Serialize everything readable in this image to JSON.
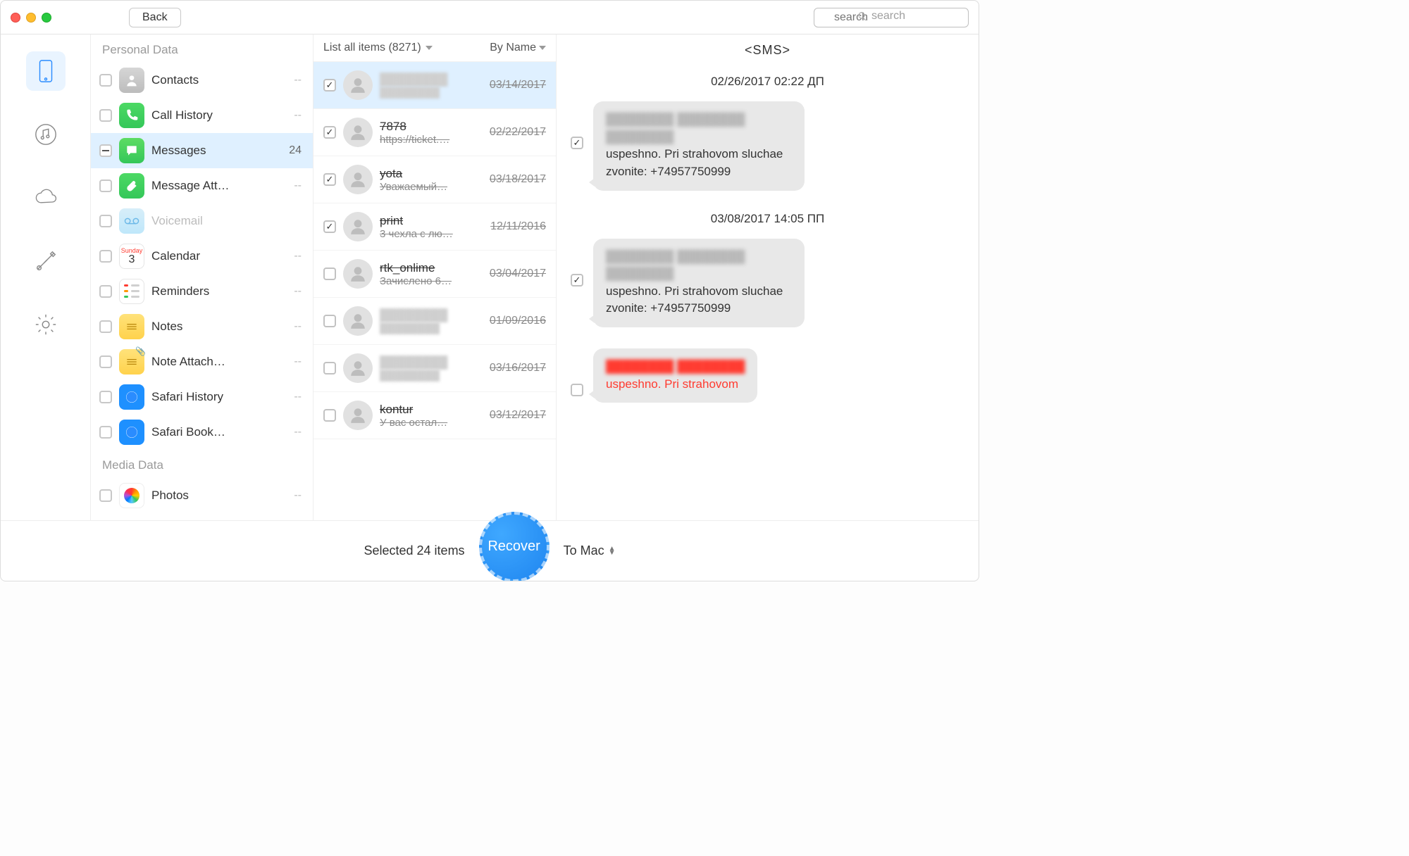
{
  "titlebar": {
    "back_label": "Back",
    "search_placeholder": "search"
  },
  "rail": [
    {
      "key": "device",
      "active": true
    },
    {
      "key": "media",
      "active": false
    },
    {
      "key": "cloud",
      "active": false
    },
    {
      "key": "tools",
      "active": false
    },
    {
      "key": "settings",
      "active": false
    }
  ],
  "categories": {
    "personal_header": "Personal Data",
    "media_header": "Media Data",
    "items": [
      {
        "key": "contacts",
        "label": "Contacts",
        "count": "--",
        "icon": "contacts"
      },
      {
        "key": "callhistory",
        "label": "Call History",
        "count": "--",
        "icon": "callhist"
      },
      {
        "key": "messages",
        "label": "Messages",
        "count": "24",
        "icon": "messages",
        "selected": true,
        "check": "minus"
      },
      {
        "key": "messageatt",
        "label": "Message Att…",
        "count": "--",
        "icon": "msgatt"
      },
      {
        "key": "voicemail",
        "label": "Voicemail",
        "count": "",
        "icon": "voicemail",
        "disabled": true
      },
      {
        "key": "calendar",
        "label": "Calendar",
        "count": "--",
        "icon": "calendar"
      },
      {
        "key": "reminders",
        "label": "Reminders",
        "count": "--",
        "icon": "reminders"
      },
      {
        "key": "notes",
        "label": "Notes",
        "count": "--",
        "icon": "notes"
      },
      {
        "key": "noteattach",
        "label": "Note Attach…",
        "count": "--",
        "icon": "noteatt"
      },
      {
        "key": "safarihistory",
        "label": "Safari History",
        "count": "--",
        "icon": "safari"
      },
      {
        "key": "safaribook",
        "label": "Safari Book…",
        "count": "--",
        "icon": "safaribm"
      }
    ],
    "media_items": [
      {
        "key": "photos",
        "label": "Photos",
        "count": "--",
        "icon": "photos"
      }
    ]
  },
  "items_panel": {
    "filter_label": "List all items (8271)",
    "sort_label": "By Name",
    "rows": [
      {
        "name": "████████",
        "sub": "████████",
        "date": "03/14/2017",
        "checked": true,
        "selected": true,
        "blur": true,
        "strike": true
      },
      {
        "name": "7878",
        "sub": "https://ticket.…",
        "date": "02/22/2017",
        "checked": true,
        "strike": true
      },
      {
        "name": "yota",
        "sub": "Уважаемый…",
        "date": "03/18/2017",
        "checked": true,
        "strike": true
      },
      {
        "name": "print",
        "sub": "3 чехла с лю…",
        "date": "12/11/2016",
        "checked": true,
        "strike": true
      },
      {
        "name": "rtk_onlime",
        "sub": "Зачислено 6…",
        "date": "03/04/2017",
        "checked": false,
        "strike": true
      },
      {
        "name": "████████",
        "sub": "████████",
        "date": "01/09/2016",
        "checked": false,
        "blur": true,
        "strike": true
      },
      {
        "name": "████████",
        "sub": "████████",
        "date": "03/16/2017",
        "checked": false,
        "blur": true,
        "strike": true
      },
      {
        "name": "kontur",
        "sub": "У вас остал…",
        "date": "03/12/2017",
        "checked": false,
        "strike": true
      }
    ]
  },
  "detail": {
    "title": "<SMS>",
    "blocks": [
      {
        "kind": "date",
        "text": "02/26/2017 02:22 ДП"
      },
      {
        "kind": "bubble",
        "checked": true,
        "blur_lines": "████████ ████████ ████████",
        "text": "uspeshno. Pri strahovom sluchae zvonite: +74957750999"
      },
      {
        "kind": "date",
        "text": "03/08/2017 14:05 ПП"
      },
      {
        "kind": "bubble",
        "checked": true,
        "blur_lines": "████████ ████████ ████████",
        "text": "uspeshno. Pri strahovom sluchae zvonite: +74957750999"
      },
      {
        "kind": "bubble",
        "checked": false,
        "red": true,
        "blur_lines": "████████ ████████",
        "text": "uspeshno. Pri strahovom"
      }
    ]
  },
  "footer": {
    "selected_label": "Selected 24 items",
    "recover_label": "Recover",
    "destination_label": "To Mac"
  }
}
